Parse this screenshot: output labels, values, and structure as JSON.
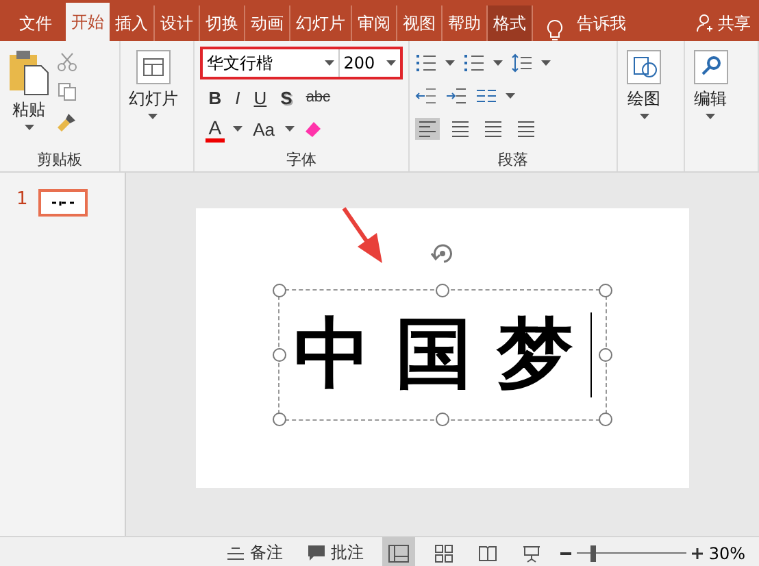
{
  "tabs": [
    {
      "label": "文件",
      "selected": false,
      "kind": "file"
    },
    {
      "label": "开始",
      "selected": true,
      "kind": "normal"
    },
    {
      "label": "插入",
      "selected": false,
      "kind": "normal"
    },
    {
      "label": "设计",
      "selected": false,
      "kind": "normal"
    },
    {
      "label": "切换",
      "selected": false,
      "kind": "normal"
    },
    {
      "label": "动画",
      "selected": false,
      "kind": "normal"
    },
    {
      "label": "幻灯片",
      "selected": false,
      "kind": "normal"
    },
    {
      "label": "审阅",
      "selected": false,
      "kind": "normal"
    },
    {
      "label": "视图",
      "selected": false,
      "kind": "normal"
    },
    {
      "label": "帮助",
      "selected": false,
      "kind": "normal"
    },
    {
      "label": "格式",
      "selected": false,
      "kind": "contextual"
    }
  ],
  "tell_me": "告诉我",
  "share": "共享",
  "ribbon": {
    "clipboard": {
      "paste": "粘贴",
      "label": "剪贴板"
    },
    "slides": {
      "new_slide": "幻灯片"
    },
    "font": {
      "font_name": "华文行楷",
      "font_size": "200",
      "highlighted": true,
      "row1": [
        "B",
        "I",
        "U",
        "S",
        "abc"
      ],
      "row2": [
        "A",
        "Aa"
      ],
      "label": "字体"
    },
    "paragraph": {
      "label": "段落"
    },
    "drawing": {
      "label": "绘图"
    },
    "editing": {
      "label": "编辑"
    }
  },
  "slide_pane": [
    {
      "number": "1",
      "selected": true
    }
  ],
  "slide": {
    "text": "中国梦",
    "selected": true,
    "arrow": true
  },
  "status_bar": {
    "notes": "备注",
    "comments": "批注",
    "zoom": "30%",
    "level": 0.12
  }
}
